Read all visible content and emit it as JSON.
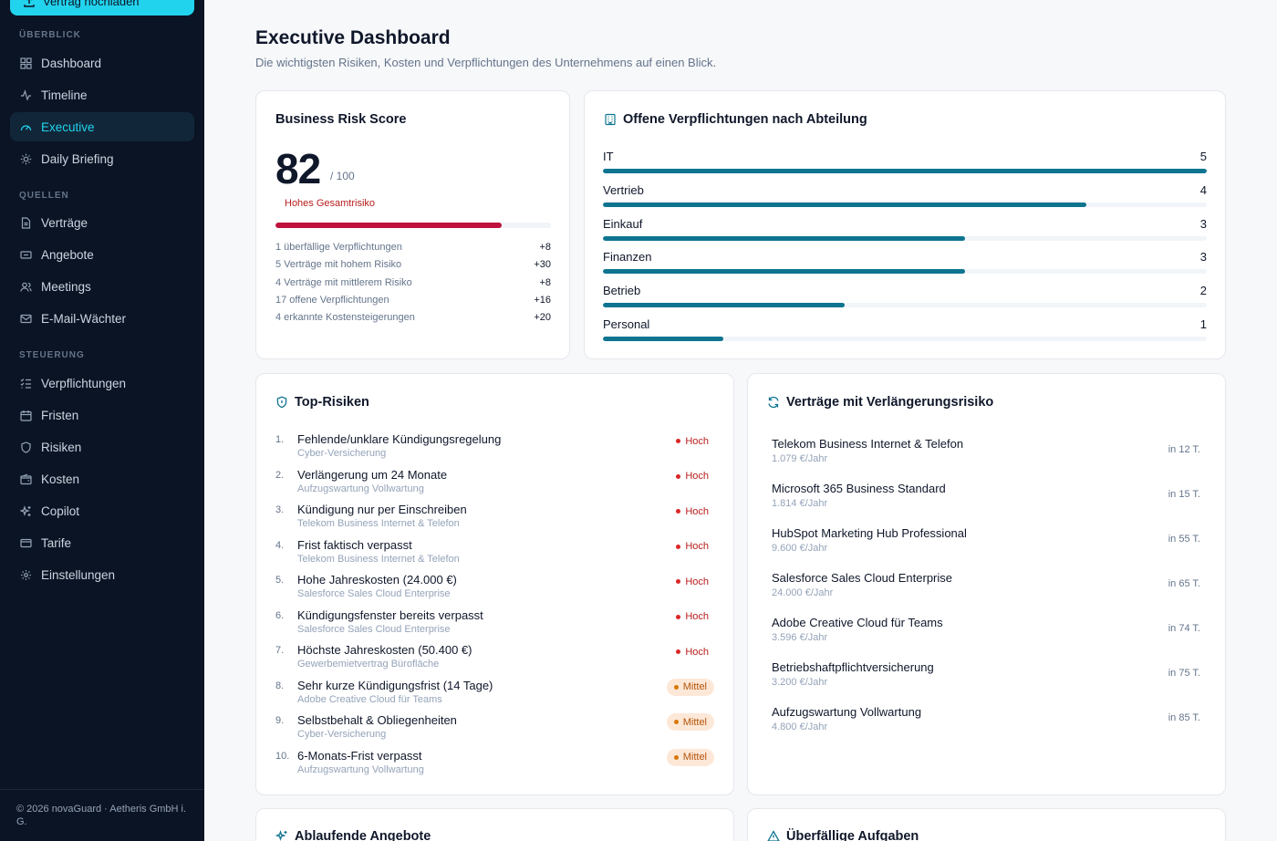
{
  "sidebar": {
    "upload_label": "Vertrag hochladen",
    "sections": {
      "ueberblick": "ÜBERBLICK",
      "quellen": "QUELLEN",
      "steuerung": "STEUERUNG"
    },
    "items": {
      "dashboard": "Dashboard",
      "timeline": "Timeline",
      "executive": "Executive",
      "daily_briefing": "Daily Briefing",
      "vertraege": "Verträge",
      "angebote": "Angebote",
      "meetings": "Meetings",
      "email_waechter": "E-Mail-Wächter",
      "verpflichtungen": "Verpflichtungen",
      "fristen": "Fristen",
      "risiken": "Risiken",
      "kosten": "Kosten",
      "copilot": "Copilot",
      "tarife": "Tarife",
      "einstellungen": "Einstellungen"
    },
    "footer": "© 2026 novaGuard · Aetheris GmbH i. G."
  },
  "header": {
    "title": "Executive Dashboard",
    "subtitle": "Die wichtigsten Risiken, Kosten und Verpflichtungen des Unternehmens auf einen Blick."
  },
  "risk_score": {
    "title": "Business Risk Score",
    "score": "82",
    "max": "/ 100",
    "level_label": "Hohes Gesamtrisiko",
    "fill_fraction": 0.82,
    "factors": [
      {
        "label": "1 überfällige Verpflichtungen",
        "value": "+8"
      },
      {
        "label": "5 Verträge mit hohem Risiko",
        "value": "+30"
      },
      {
        "label": "4 Verträge mit mittlerem Risiko",
        "value": "+8"
      },
      {
        "label": "17 offene Verpflichtungen",
        "value": "+16"
      },
      {
        "label": "4 erkannte Kostensteigerungen",
        "value": "+20"
      }
    ]
  },
  "departments": {
    "title": "Offene Verpflichtungen nach Abteilung",
    "max": 5,
    "items": [
      {
        "name": "IT",
        "count": "5",
        "value": 5
      },
      {
        "name": "Vertrieb",
        "count": "4",
        "value": 4
      },
      {
        "name": "Einkauf",
        "count": "3",
        "value": 3
      },
      {
        "name": "Finanzen",
        "count": "3",
        "value": 3
      },
      {
        "name": "Betrieb",
        "count": "2",
        "value": 2
      },
      {
        "name": "Personal",
        "count": "1",
        "value": 1
      }
    ]
  },
  "top_risks": {
    "title": "Top-Risiken",
    "items": [
      {
        "num": "1.",
        "title": "Fehlende/unklare Kündigungsregelung",
        "sub": "Cyber-Versicherung",
        "level": "Hoch"
      },
      {
        "num": "2.",
        "title": "Verlängerung um 24 Monate",
        "sub": "Aufzugswartung Vollwartung",
        "level": "Hoch"
      },
      {
        "num": "3.",
        "title": "Kündigung nur per Einschreiben",
        "sub": "Telekom Business Internet & Telefon",
        "level": "Hoch"
      },
      {
        "num": "4.",
        "title": "Frist faktisch verpasst",
        "sub": "Telekom Business Internet & Telefon",
        "level": "Hoch"
      },
      {
        "num": "5.",
        "title": "Hohe Jahreskosten (24.000 €)",
        "sub": "Salesforce Sales Cloud Enterprise",
        "level": "Hoch"
      },
      {
        "num": "6.",
        "title": "Kündigungsfenster bereits verpasst",
        "sub": "Salesforce Sales Cloud Enterprise",
        "level": "Hoch"
      },
      {
        "num": "7.",
        "title": "Höchste Jahreskosten (50.400 €)",
        "sub": "Gewerbemietvertrag Bürofläche",
        "level": "Hoch"
      },
      {
        "num": "8.",
        "title": "Sehr kurze Kündigungsfrist (14 Tage)",
        "sub": "Adobe Creative Cloud für Teams",
        "level": "Mittel"
      },
      {
        "num": "9.",
        "title": "Selbstbehalt & Obliegenheiten",
        "sub": "Cyber-Versicherung",
        "level": "Mittel"
      },
      {
        "num": "10.",
        "title": "6-Monats-Frist verpasst",
        "sub": "Aufzugswartung Vollwartung",
        "level": "Mittel"
      }
    ]
  },
  "renewals": {
    "title": "Verträge mit Verlängerungsrisiko",
    "items": [
      {
        "name": "Telekom Business Internet & Telefon",
        "cost": "1.079 €/Jahr",
        "days": "in 12 T."
      },
      {
        "name": "Microsoft 365 Business Standard",
        "cost": "1.814 €/Jahr",
        "days": "in 15 T."
      },
      {
        "name": "HubSpot Marketing Hub Professional",
        "cost": "9.600 €/Jahr",
        "days": "in 55 T."
      },
      {
        "name": "Salesforce Sales Cloud Enterprise",
        "cost": "24.000 €/Jahr",
        "days": "in 65 T."
      },
      {
        "name": "Adobe Creative Cloud für Teams",
        "cost": "3.596 €/Jahr",
        "days": "in 74 T."
      },
      {
        "name": "Betriebshaftpflichtversicherung",
        "cost": "3.200 €/Jahr",
        "days": "in 75 T."
      },
      {
        "name": "Aufzugswartung Vollwartung",
        "cost": "4.800 €/Jahr",
        "days": "in 85 T."
      }
    ]
  },
  "bottom_cards": {
    "offers_title": "Ablaufende Angebote",
    "overdue_title": "Überfällige Aufgaben"
  },
  "colors": {
    "accent": "#22d3ee",
    "bar": "#0e7490",
    "risk_high": "#be123c",
    "sidebar_bg": "#0b1424"
  }
}
